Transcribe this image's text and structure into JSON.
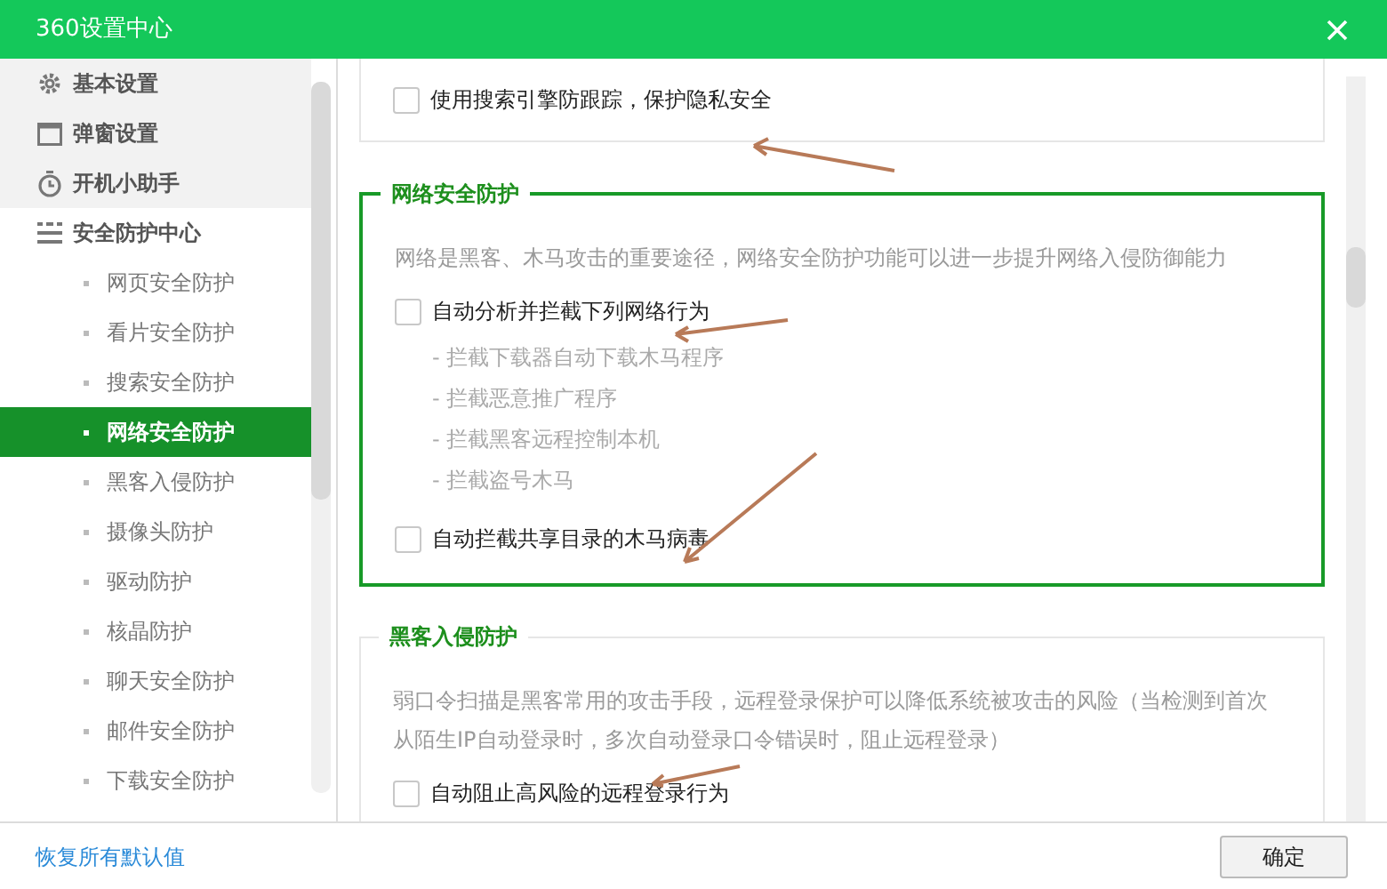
{
  "window": {
    "title": "360设置中心"
  },
  "sidebar": {
    "items": [
      {
        "label": "基本设置",
        "selected": false
      },
      {
        "label": "弹窗设置",
        "selected": false
      },
      {
        "label": "开机小助手",
        "selected": false
      },
      {
        "label": "安全防护中心",
        "selected": false,
        "children": [
          {
            "label": "网页安全防护",
            "selected": false
          },
          {
            "label": "看片安全防护",
            "selected": false
          },
          {
            "label": "搜索安全防护",
            "selected": false
          },
          {
            "label": "网络安全防护",
            "selected": true
          },
          {
            "label": "黑客入侵防护",
            "selected": false
          },
          {
            "label": "摄像头防护",
            "selected": false
          },
          {
            "label": "驱动防护",
            "selected": false
          },
          {
            "label": "核晶防护",
            "selected": false
          },
          {
            "label": "聊天安全防护",
            "selected": false
          },
          {
            "label": "邮件安全防护",
            "selected": false
          },
          {
            "label": "下载安全防护",
            "selected": false
          }
        ]
      }
    ]
  },
  "sections": [
    {
      "highlighted": false,
      "options": [
        {
          "label": "使用搜索引擎防跟踪，保护隐私安全",
          "checked": false
        }
      ]
    },
    {
      "title": "网络安全防护",
      "highlighted": true,
      "description": "网络是黑客、木马攻击的重要途径，网络安全防护功能可以进一步提升网络入侵防御能力",
      "options": [
        {
          "label": "自动分析并拦截下列网络行为",
          "checked": false,
          "sub_items": [
            "- 拦截下载器自动下载木马程序",
            "- 拦截恶意推广程序",
            "- 拦截黑客远程控制本机",
            "- 拦截盗号木马"
          ]
        },
        {
          "label": "自动拦截共享目录的木马病毒",
          "checked": false
        }
      ]
    },
    {
      "title": "黑客入侵防护",
      "highlighted": false,
      "description": "弱口令扫描是黑客常用的攻击手段，远程登录保护可以降低系统被攻击的风险（当检测到首次从陌生IP自动登录时，多次自动登录口令错误时，阻止远程登录）",
      "options": [
        {
          "label": "自动阻止高风险的远程登录行为",
          "checked": false
        }
      ]
    }
  ],
  "footer": {
    "restore_link": "恢复所有默认值",
    "ok_button": "确定"
  }
}
